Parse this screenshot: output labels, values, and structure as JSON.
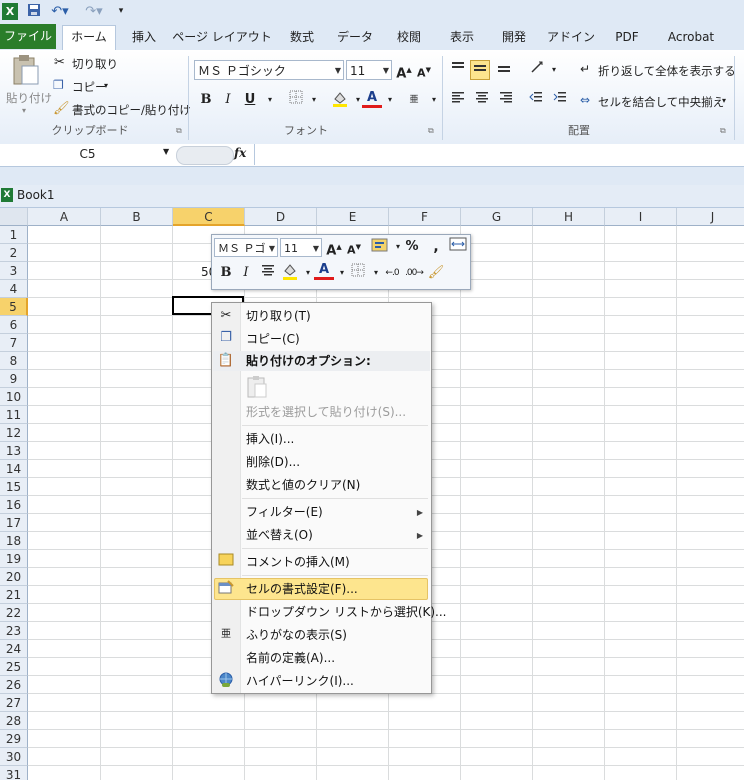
{
  "qat": {
    "app_icon": "excel-icon",
    "save_icon": "save-icon",
    "undo_icon": "undo-icon",
    "redo_icon": "redo-icon"
  },
  "tabs": [
    "ファイル",
    "ホーム",
    "挿入",
    "ページ レイアウト",
    "数式",
    "データ",
    "校閲",
    "表示",
    "開発",
    "アドイン",
    "PDF",
    "Acrobat"
  ],
  "ribbon": {
    "clipboard": {
      "paste": "貼り付け",
      "cut": "切り取り",
      "copy": "コピー",
      "format_painter": "書式のコピー/貼り付け",
      "label": "クリップボード"
    },
    "font": {
      "font_name": "ＭＳ Ｐゴシック",
      "font_size": "11",
      "label": "フォント"
    },
    "alignment": {
      "wrap": "折り返して全体を表示する",
      "merge": "セルを結合して中央揃え",
      "label": "配置"
    }
  },
  "formula_bar": {
    "name_box": "C5",
    "fx": "fx",
    "formula": ""
  },
  "workbook": {
    "title": "Book1"
  },
  "grid": {
    "columns": [
      "A",
      "B",
      "C",
      "D",
      "E",
      "F",
      "G",
      "H",
      "I",
      "J"
    ],
    "rows": [
      "1",
      "2",
      "3",
      "4",
      "5",
      "6",
      "7",
      "8",
      "9",
      "10",
      "11",
      "12",
      "13",
      "14",
      "15",
      "16",
      "17",
      "18",
      "19",
      "20",
      "21",
      "22",
      "23",
      "24",
      "25",
      "26",
      "27",
      "28",
      "29",
      "30",
      "31"
    ],
    "active_cell": "C5",
    "c3_partial_value": "50"
  },
  "mini_toolbar": {
    "font_name": "ＭＳ Ｐゴ",
    "font_size": "11",
    "percent": "%",
    "comma": ",",
    "bold": "B",
    "italic": "I"
  },
  "context_menu": {
    "cut": "切り取り(T)",
    "copy": "コピー(C)",
    "paste_options": "貼り付けのオプション:",
    "paste_special": "形式を選択して貼り付け(S)...",
    "insert": "挿入(I)...",
    "delete": "削除(D)...",
    "clear": "数式と値のクリア(N)",
    "filter": "フィルター(E)",
    "sort": "並べ替え(O)",
    "insert_comment": "コメントの挿入(M)",
    "format_cells": "セルの書式設定(F)...",
    "dropdown": "ドロップダウン リストから選択(K)...",
    "phonetic": "ふりがなの表示(S)",
    "define_name": "名前の定義(A)...",
    "hyperlink": "ハイパーリンク(I)..."
  },
  "colors": {
    "file_tab": "#2a7d2a",
    "highlight": "#fde58e",
    "selection": "#000000"
  }
}
